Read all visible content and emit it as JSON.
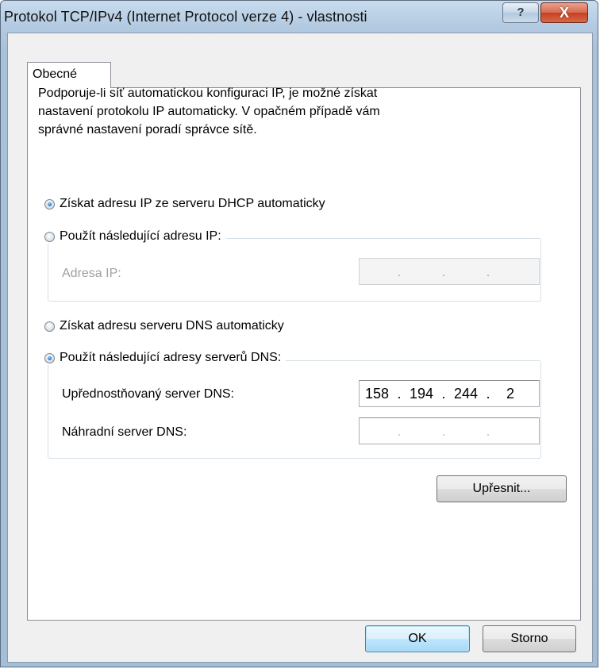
{
  "window": {
    "title": "Protokol TCP/IPv4 (Internet Protocol verze 4) - vlastnosti",
    "help_label": "?",
    "close_label": "X"
  },
  "tabs": [
    {
      "label": "Obecné"
    }
  ],
  "intro_text": {
    "line1": "Podporuje-li síť automatickou konfiguraci IP, je možné získat",
    "line2": "nastavení protokolu IP automaticky. V opačném případě vám",
    "line3": "správné nastavení poradí správce sítě."
  },
  "ip": {
    "auto_label": "Získat adresu IP ze serveru DHCP automaticky",
    "auto_selected": true,
    "manual_label": "Použít následující adresu IP:",
    "manual_selected": false,
    "address_label": "Adresa IP:",
    "address_octets": [
      "",
      "",
      "",
      ""
    ]
  },
  "dns": {
    "auto_label": "Získat adresu serveru DNS automaticky",
    "auto_selected": false,
    "manual_label": "Použít následující adresy serverů DNS:",
    "manual_selected": true,
    "preferred_label": "Upřednostňovaný server DNS:",
    "preferred_octets": [
      "158",
      "194",
      "244",
      "2"
    ],
    "alternate_label": "Náhradní server DNS:",
    "alternate_octets": [
      "",
      "",
      "",
      ""
    ]
  },
  "buttons": {
    "advanced": "Upřesnit...",
    "ok": "OK",
    "cancel": "Storno"
  },
  "colors": {
    "title_bar": "#b4cbe2",
    "close_button": "#c4411f",
    "default_button_border": "#3c7fb1",
    "radio_selected": "#1b6fd1"
  }
}
